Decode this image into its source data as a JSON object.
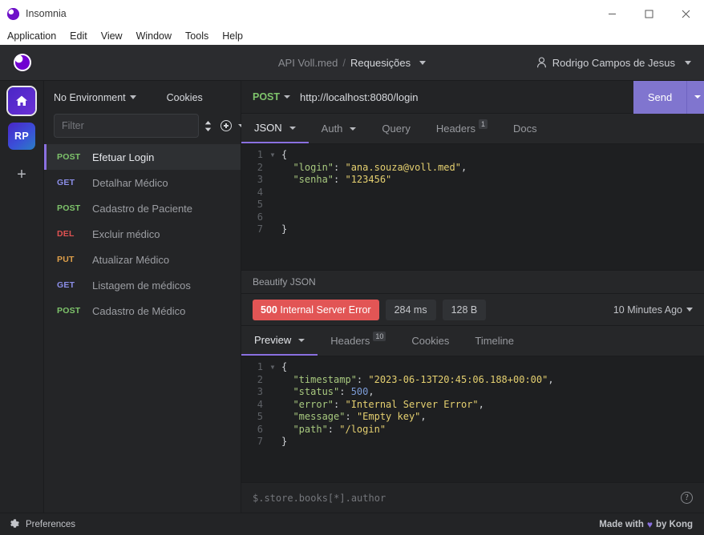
{
  "window": {
    "app_title": "Insomnia",
    "minimize_label": "Minimize",
    "maximize_label": "Maximize",
    "close_label": "Close"
  },
  "menubar": {
    "items": [
      {
        "label": "Application"
      },
      {
        "label": "Edit"
      },
      {
        "label": "View"
      },
      {
        "label": "Window"
      },
      {
        "label": "Tools"
      },
      {
        "label": "Help"
      }
    ]
  },
  "header": {
    "workspace": "API Voll.med",
    "separator": "/",
    "folder": "Requesições",
    "user": "Rodrigo Campos de Jesus"
  },
  "rail": {
    "home_label": "Home",
    "workspace_initials": "RP",
    "add_label": "+"
  },
  "sidebar": {
    "environment": "No Environment",
    "cookies": "Cookies",
    "filter_placeholder": "Filter",
    "sort_label": "Sort",
    "create_label": "Create",
    "requests": [
      {
        "method": "POST",
        "name": "Efetuar Login",
        "color": "#7ec46b",
        "active": true
      },
      {
        "method": "GET",
        "name": "Detalhar Médico",
        "color": "#8b8ee8",
        "active": false
      },
      {
        "method": "POST",
        "name": "Cadastro de Paciente",
        "color": "#7ec46b",
        "active": false
      },
      {
        "method": "DEL",
        "name": "Excluir médico",
        "color": "#e05252",
        "active": false
      },
      {
        "method": "PUT",
        "name": "Atualizar Médico",
        "color": "#e0a04a",
        "active": false
      },
      {
        "method": "GET",
        "name": "Listagem de médicos",
        "color": "#8b8ee8",
        "active": false
      },
      {
        "method": "POST",
        "name": "Cadastro de Médico",
        "color": "#7ec46b",
        "active": false
      }
    ]
  },
  "request": {
    "method": "POST",
    "url": "http://localhost:8080/login",
    "send_label": "Send",
    "tabs": [
      {
        "label": "JSON",
        "active": true,
        "caret": true,
        "badge": ""
      },
      {
        "label": "Auth",
        "active": false,
        "caret": true,
        "badge": ""
      },
      {
        "label": "Query",
        "active": false,
        "caret": false,
        "badge": ""
      },
      {
        "label": "Headers",
        "active": false,
        "caret": false,
        "badge": "1"
      },
      {
        "label": "Docs",
        "active": false,
        "caret": false,
        "badge": ""
      }
    ],
    "body_lines": [
      {
        "num": "1",
        "fold": "▾",
        "tokens": [
          {
            "t": "{",
            "c": "p"
          }
        ]
      },
      {
        "num": "2",
        "fold": "",
        "tokens": [
          {
            "t": "  \"login\"",
            "c": "k"
          },
          {
            "t": ": ",
            "c": "p"
          },
          {
            "t": "\"ana.souza@voll.med\"",
            "c": "s"
          },
          {
            "t": ",",
            "c": "p"
          }
        ]
      },
      {
        "num": "3",
        "fold": "",
        "tokens": [
          {
            "t": "  \"senha\"",
            "c": "k"
          },
          {
            "t": ": ",
            "c": "p"
          },
          {
            "t": "\"123456\"",
            "c": "s"
          }
        ]
      },
      {
        "num": "4",
        "fold": "",
        "tokens": []
      },
      {
        "num": "5",
        "fold": "",
        "tokens": []
      },
      {
        "num": "6",
        "fold": "",
        "tokens": []
      },
      {
        "num": "7",
        "fold": "",
        "tokens": [
          {
            "t": "}",
            "c": "p"
          }
        ]
      }
    ]
  },
  "beautify": {
    "label": "Beautify JSON"
  },
  "response": {
    "status_code": "500",
    "status_text": "Internal Server Error",
    "status_color": "#e25555",
    "time": "284 ms",
    "size": "128 B",
    "when": "10 Minutes Ago",
    "tabs": [
      {
        "label": "Preview",
        "active": true,
        "caret": true,
        "badge": ""
      },
      {
        "label": "Headers",
        "active": false,
        "caret": false,
        "badge": "10"
      },
      {
        "label": "Cookies",
        "active": false,
        "caret": false,
        "badge": ""
      },
      {
        "label": "Timeline",
        "active": false,
        "caret": false,
        "badge": ""
      }
    ],
    "body_lines": [
      {
        "num": "1",
        "fold": "▾",
        "tokens": [
          {
            "t": "{",
            "c": "p"
          }
        ]
      },
      {
        "num": "2",
        "fold": "",
        "tokens": [
          {
            "t": "  \"timestamp\"",
            "c": "k"
          },
          {
            "t": ": ",
            "c": "p"
          },
          {
            "t": "\"2023-06-13T20:45:06.188+00:00\"",
            "c": "s"
          },
          {
            "t": ",",
            "c": "p"
          }
        ]
      },
      {
        "num": "3",
        "fold": "",
        "tokens": [
          {
            "t": "  \"status\"",
            "c": "k"
          },
          {
            "t": ": ",
            "c": "p"
          },
          {
            "t": "500",
            "c": "n"
          },
          {
            "t": ",",
            "c": "p"
          }
        ]
      },
      {
        "num": "4",
        "fold": "",
        "tokens": [
          {
            "t": "  \"error\"",
            "c": "k"
          },
          {
            "t": ": ",
            "c": "p"
          },
          {
            "t": "\"Internal Server Error\"",
            "c": "s"
          },
          {
            "t": ",",
            "c": "p"
          }
        ]
      },
      {
        "num": "5",
        "fold": "",
        "tokens": [
          {
            "t": "  \"message\"",
            "c": "k"
          },
          {
            "t": ": ",
            "c": "p"
          },
          {
            "t": "\"Empty key\"",
            "c": "s"
          },
          {
            "t": ",",
            "c": "p"
          }
        ]
      },
      {
        "num": "6",
        "fold": "",
        "tokens": [
          {
            "t": "  \"path\"",
            "c": "k"
          },
          {
            "t": ": ",
            "c": "p"
          },
          {
            "t": "\"/login\"",
            "c": "s"
          }
        ]
      },
      {
        "num": "7",
        "fold": "",
        "tokens": [
          {
            "t": "}",
            "c": "p"
          }
        ]
      }
    ],
    "filter_placeholder": "$.store.books[*].author",
    "help_label": "?"
  },
  "footer": {
    "preferences": "Preferences",
    "made_prefix": "Made with",
    "made_suffix": "by Kong",
    "heart": "♥"
  }
}
